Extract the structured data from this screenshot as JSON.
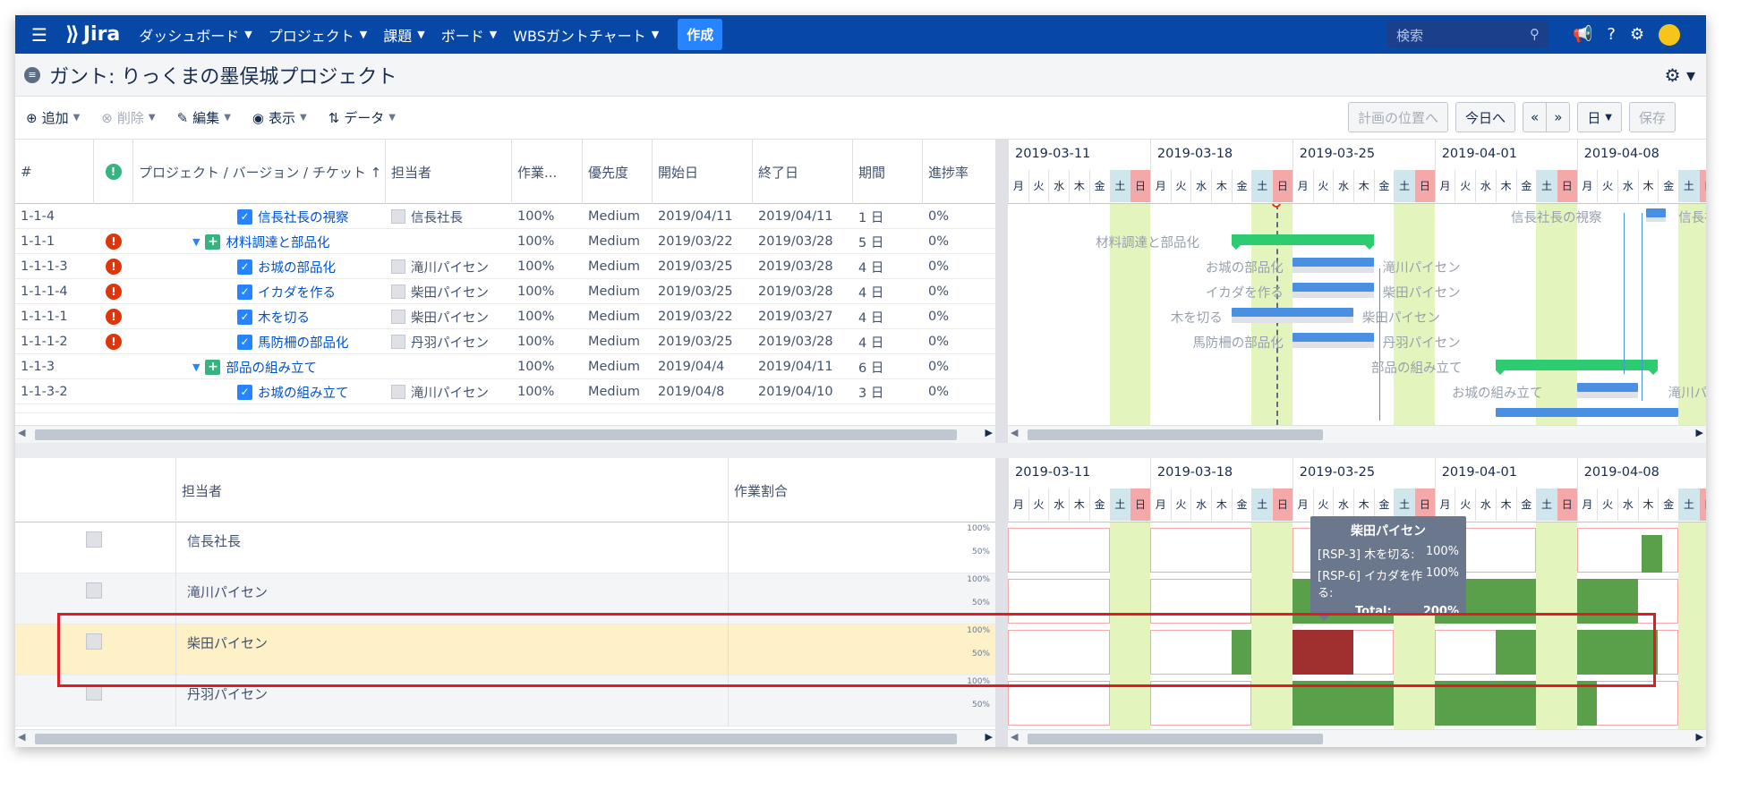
{
  "nav": {
    "menu_icon": "hamburger-icon",
    "logo_text": "Jira",
    "items": [
      "ダッシュボード",
      "プロジェクト",
      "課題",
      "ボード",
      "WBSガントチャート"
    ],
    "create": "作成",
    "search_placeholder": "検索"
  },
  "page": {
    "title": "ガント: りっくまの墨俣城プロジェクト"
  },
  "toolbar": {
    "add": "追加",
    "delete": "削除",
    "edit": "編集",
    "view": "表示",
    "data": "データ",
    "plan_position": "計画の位置へ",
    "today": "今日へ",
    "prev": "«",
    "next": "»",
    "scale": "日",
    "save": "保存"
  },
  "grid": {
    "headers": [
      "#",
      "",
      "プロジェクト / バージョン / チケット ↑",
      "担当者",
      "作業...",
      "優先度",
      "開始日",
      "終了日",
      "期間",
      "進捗率"
    ],
    "rows": [
      {
        "id": "1-1-4",
        "warn": "",
        "title": "信長社長の視察",
        "kind": "task",
        "indent": 2,
        "assignee": "信長社長",
        "work": "100%",
        "priority": "Medium",
        "start": "2019/04/11",
        "end": "2019/04/11",
        "duration": "1 日",
        "progress": "0%"
      },
      {
        "id": "1-1-1",
        "warn": "!",
        "title": "材料調達と部品化",
        "kind": "group",
        "indent": 1,
        "assignee": "",
        "work": "100%",
        "priority": "Medium",
        "start": "2019/03/22",
        "end": "2019/03/28",
        "duration": "5 日",
        "progress": "0%"
      },
      {
        "id": "1-1-1-3",
        "warn": "!",
        "title": "お城の部品化",
        "kind": "task",
        "indent": 2,
        "assignee": "滝川パイセン",
        "work": "100%",
        "priority": "Medium",
        "start": "2019/03/25",
        "end": "2019/03/28",
        "duration": "4 日",
        "progress": "0%"
      },
      {
        "id": "1-1-1-4",
        "warn": "!",
        "title": "イカダを作る",
        "kind": "task",
        "indent": 2,
        "assignee": "柴田パイセン",
        "work": "100%",
        "priority": "Medium",
        "start": "2019/03/25",
        "end": "2019/03/28",
        "duration": "4 日",
        "progress": "0%"
      },
      {
        "id": "1-1-1-1",
        "warn": "!",
        "title": "木を切る",
        "kind": "task",
        "indent": 2,
        "assignee": "柴田パイセン",
        "work": "100%",
        "priority": "Medium",
        "start": "2019/03/22",
        "end": "2019/03/27",
        "duration": "4 日",
        "progress": "0%"
      },
      {
        "id": "1-1-1-2",
        "warn": "!",
        "title": "馬防柵の部品化",
        "kind": "task",
        "indent": 2,
        "assignee": "丹羽パイセン",
        "work": "100%",
        "priority": "Medium",
        "start": "2019/03/25",
        "end": "2019/03/28",
        "duration": "4 日",
        "progress": "0%"
      },
      {
        "id": "1-1-3",
        "warn": "",
        "title": "部品の組み立て",
        "kind": "group",
        "indent": 1,
        "assignee": "",
        "work": "100%",
        "priority": "Medium",
        "start": "2019/04/4",
        "end": "2019/04/11",
        "duration": "6 日",
        "progress": "0%"
      },
      {
        "id": "1-1-3-2",
        "warn": "",
        "title": "お城の組み立て",
        "kind": "task",
        "indent": 2,
        "assignee": "滝川パイセン",
        "work": "100%",
        "priority": "Medium",
        "start": "2019/04/8",
        "end": "2019/04/10",
        "duration": "3 日",
        "progress": "0%"
      }
    ]
  },
  "timeline": {
    "weeks": [
      "2019-03-11",
      "2019-03-18",
      "2019-03-25",
      "2019-04-01",
      "2019-04-08"
    ],
    "days": [
      "月",
      "火",
      "水",
      "木",
      "金",
      "土",
      "日"
    ]
  },
  "gantt_labels": {
    "l1": "信長社長の視察",
    "l1r": "信長社",
    "l2": "材料調達と部品化",
    "l3": "お城の部品化",
    "l3r": "滝川パイセン",
    "l4": "イカダを作る",
    "l4r": "柴田パイセン",
    "l5": "木を切る",
    "l5r": "柴田パイセン",
    "l6": "馬防柵の部品化",
    "l6r": "丹羽パイセン",
    "l7": "部品の組み立て",
    "l8": "お城の組み立て",
    "l8r": "滝川パイ"
  },
  "resources": {
    "headers": [
      "担当者",
      "作業割合"
    ],
    "people": [
      "信長社長",
      "滝川パイセン",
      "柴田パイセン",
      "丹羽パイセン"
    ],
    "scale_100": "100%",
    "scale_50": "50%"
  },
  "tooltip": {
    "title": "柴田パイセン",
    "rows": [
      {
        "label": "[RSP-3] 木を切る:",
        "value": "100%"
      },
      {
        "label": "[RSP-6] イカダを作る:",
        "value": "100%"
      },
      {
        "label": "Total:",
        "value": "200%"
      }
    ]
  },
  "colors": {
    "nav": "#0747a6",
    "weekend": "#e3f5bc",
    "overload": "#a0302f",
    "load": "#5a9f4a",
    "highlight": "#e01b24"
  }
}
